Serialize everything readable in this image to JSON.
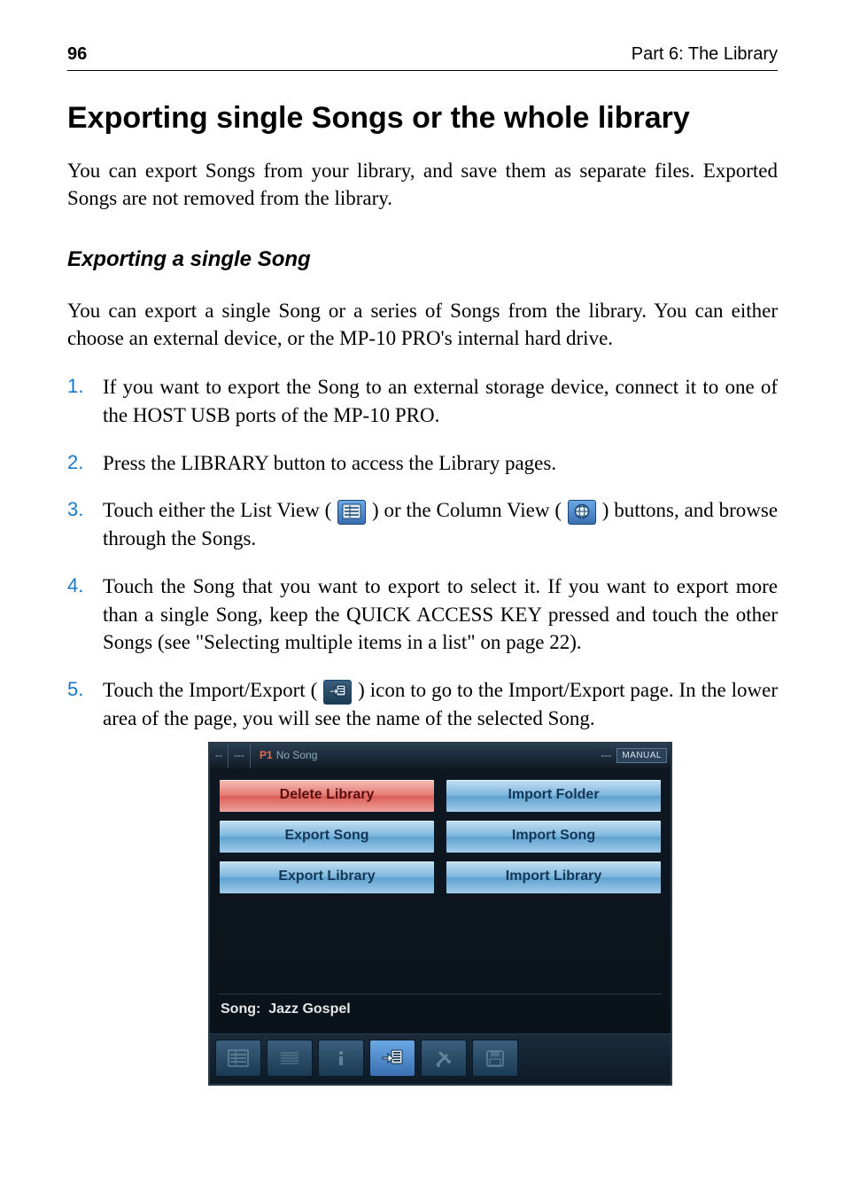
{
  "header": {
    "page_number": "96",
    "part_label": "Part 6: The Library"
  },
  "section": {
    "title": "Exporting single Songs or the whole library",
    "intro": "You can export Songs from your library, and save them as separate files. Exported Songs are not removed from the library.",
    "subsection_title": "Exporting a single Song",
    "sub_intro": "You can export a single Song or a series of Songs from the library. You can either choose an external device, or the MP-10 PRO's internal hard drive."
  },
  "steps": {
    "s1": "If you want to export the Song to an external storage device, connect it to one of the HOST USB ports of the MP-10 PRO.",
    "s2": "Press the LIBRARY button to access the Library pages.",
    "s3a": "Touch either the List View (",
    "s3b": ") or the Column View (",
    "s3c": ") buttons, and browse through the Songs.",
    "s4": "Touch the Song that you want to export to select it. If you want to export more than a single Song, keep the QUICK ACCESS KEY pressed and touch the other Songs (see \"Selecting multiple items in a list\" on page 22).",
    "s5a": "Touch the Import/Export (",
    "s5b": ") icon to go to the Import/Export page. In the lower area of the page, you will see the name of the selected Song."
  },
  "ui": {
    "titlebar": {
      "seg1": "--",
      "seg2": "---",
      "p1": "P1",
      "no_song": "No Song",
      "seg_right": "---",
      "manual": "MANUAL"
    },
    "buttons": {
      "delete_library": "Delete Library",
      "import_folder": "Import Folder",
      "export_song": "Export Song",
      "import_song": "Import Song",
      "export_library": "Export Library",
      "import_library": "Import Library"
    },
    "song_row_label": "Song:",
    "song_row_value": "Jazz Gospel"
  }
}
